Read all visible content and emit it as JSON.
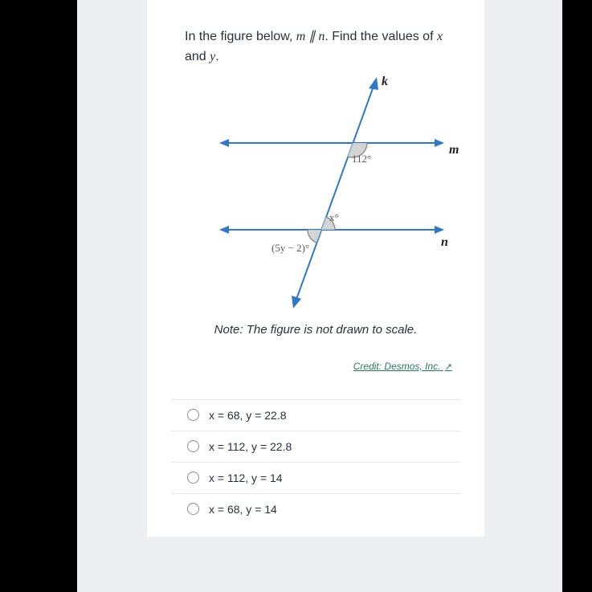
{
  "question": {
    "prefix": "In the figure below, ",
    "parallel": "m ∥ n",
    "middle": ". Find the values of ",
    "vars": "x",
    "and": " and ",
    "vars2": "y",
    "suffix": "."
  },
  "figure": {
    "line_k": "k",
    "line_m": "m",
    "line_n": "n",
    "angle_top": "112°",
    "angle_x": "x°",
    "angle_bottom": "(5y − 2)°"
  },
  "note": "Note: The figure is not drawn to scale.",
  "credit": {
    "text": "Credit: Desmos, Inc.",
    "ext": "↗"
  },
  "options": [
    {
      "label": "x = 68, y = 22.8"
    },
    {
      "label": "x = 112, y = 22.8"
    },
    {
      "label": "x = 112, y = 14"
    },
    {
      "label": "x = 68, y = 14"
    }
  ]
}
